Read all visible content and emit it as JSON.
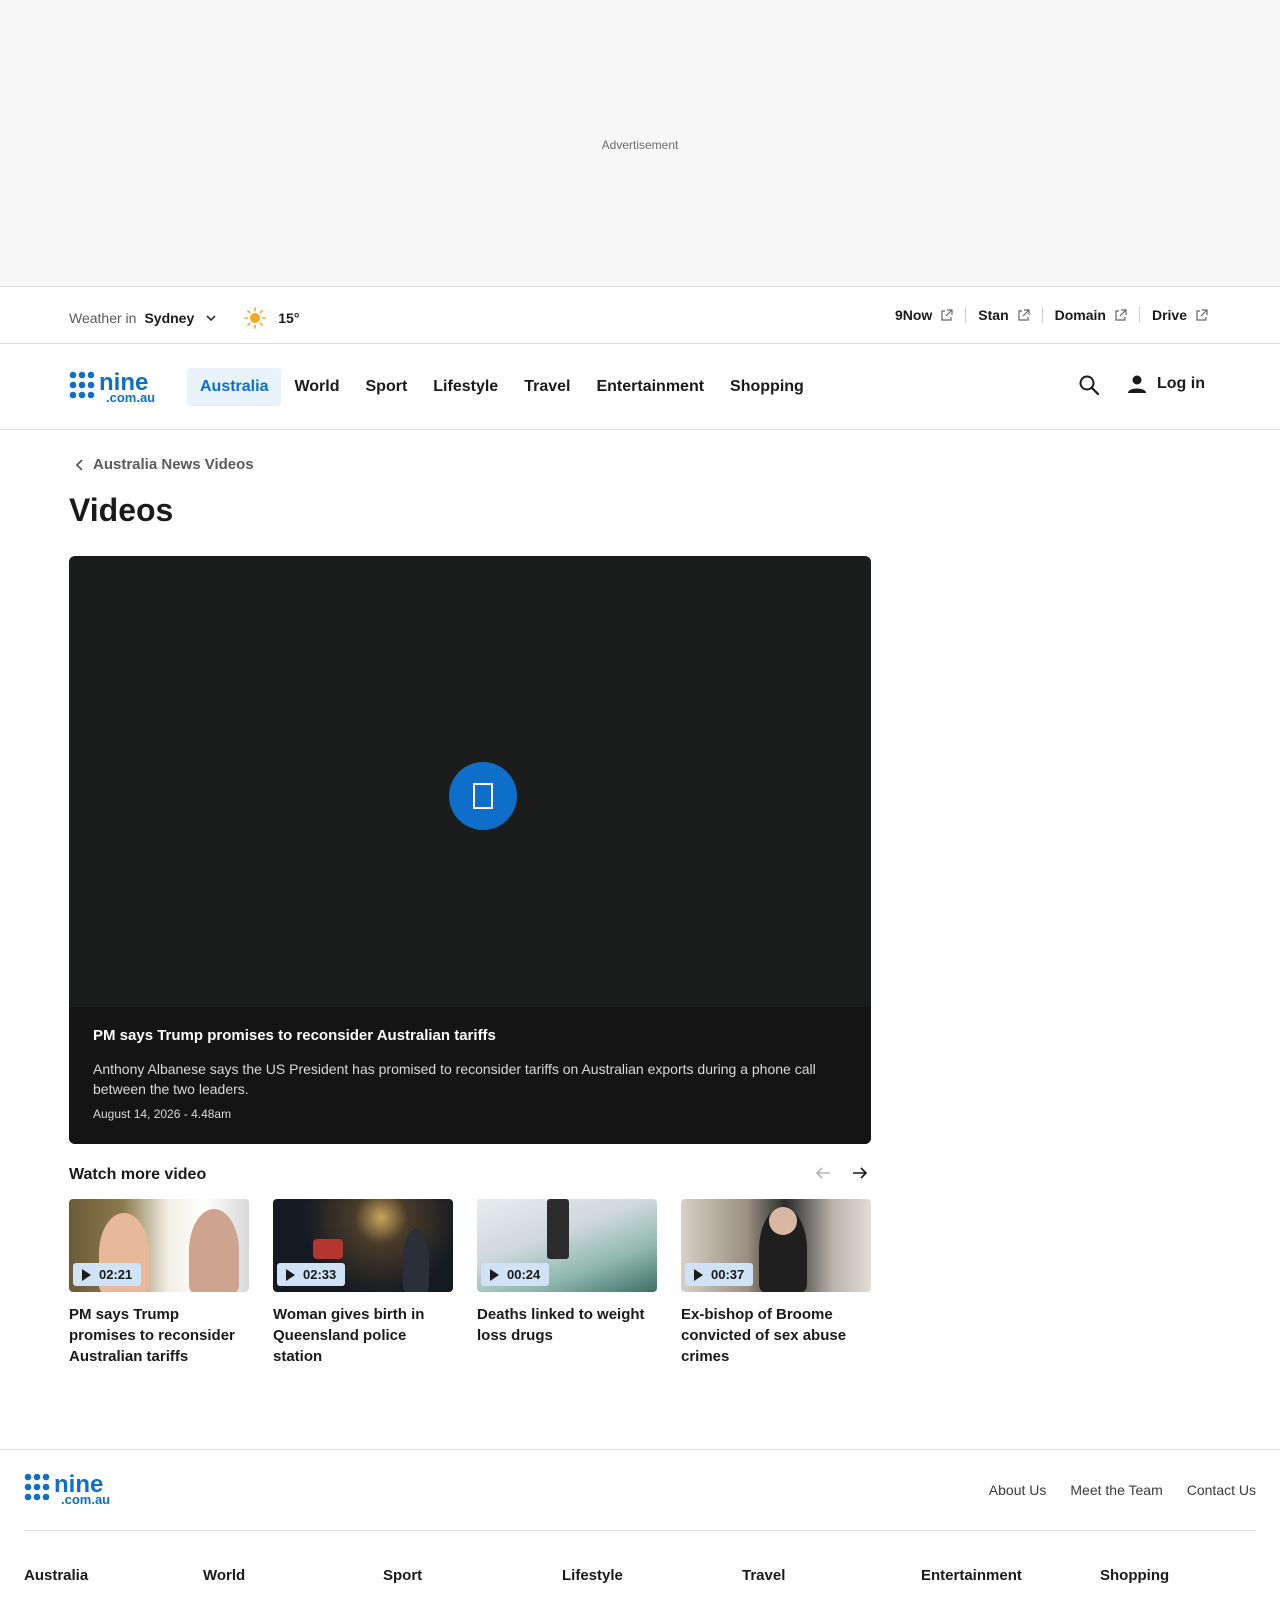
{
  "ad": {
    "label": "Advertisement"
  },
  "utility": {
    "weather_label": "Weather in",
    "city": "Sydney",
    "temperature": "15°",
    "external_links": [
      {
        "label": "9Now"
      },
      {
        "label": "Stan"
      },
      {
        "label": "Domain"
      },
      {
        "label": "Drive"
      }
    ]
  },
  "nav": {
    "logo_text": "nine.com.au",
    "links": [
      {
        "label": "Australia",
        "active": true
      },
      {
        "label": "World"
      },
      {
        "label": "Sport"
      },
      {
        "label": "Lifestyle"
      },
      {
        "label": "Travel"
      },
      {
        "label": "Entertainment"
      },
      {
        "label": "Shopping"
      }
    ],
    "login_label": "Log in"
  },
  "breadcrumb": {
    "label": "Australia News Videos"
  },
  "page_title": "Videos",
  "player": {
    "title": "PM says Trump promises to reconsider Australian tariffs",
    "description": "Anthony Albanese says the US President has promised to reconsider tariffs on Australian exports during a phone call between the two leaders.",
    "date": "August 14, 2026 - 4.48am"
  },
  "watch_more": {
    "title": "Watch more video",
    "items": [
      {
        "duration": "02:21",
        "title": "PM says Trump promises to reconsider Australian tariffs"
      },
      {
        "duration": "02:33",
        "title": "Woman gives birth in Queensland police station"
      },
      {
        "duration": "00:24",
        "title": "Deaths linked to weight loss drugs"
      },
      {
        "duration": "00:37",
        "title": "Ex-bishop of Broome convicted of sex abuse crimes"
      }
    ]
  },
  "footer": {
    "links": [
      "About Us",
      "Meet the Team",
      "Contact Us"
    ],
    "sections": [
      "Australia",
      "World",
      "Sport",
      "Lifestyle",
      "Travel",
      "Entertainment",
      "Shopping"
    ]
  },
  "colors": {
    "brand": "#0d6fc9",
    "accent_bg": "#e8f2fb",
    "player_bg": "#1b1d1c"
  }
}
